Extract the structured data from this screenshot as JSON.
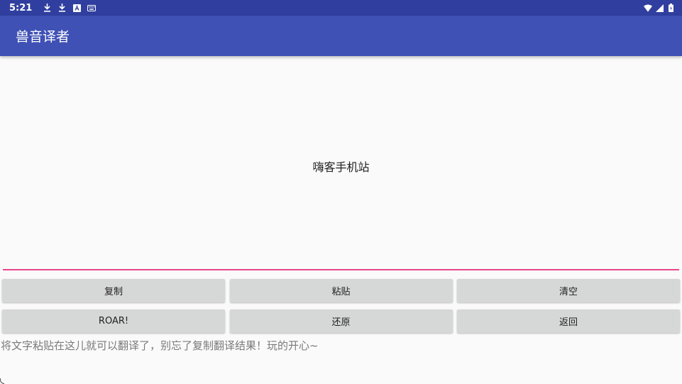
{
  "status_bar": {
    "time": "5:21",
    "left_icons": [
      "download-icon",
      "download-icon",
      "a-box-icon",
      "keyboard-icon"
    ],
    "right_icons": [
      "wifi-icon",
      "signal-icon",
      "battery-icon"
    ],
    "background": "#303f9f"
  },
  "app_bar": {
    "title": "兽音译者",
    "background": "#3f51b5"
  },
  "output": {
    "text": "嗨客手机站"
  },
  "input": {
    "underline_color": "#e8478b"
  },
  "buttons": {
    "row1": [
      "复制",
      "粘贴",
      "清空"
    ],
    "row2": [
      "ROAR!",
      "还原",
      "返回"
    ]
  },
  "hint": {
    "text": "将文字粘贴在这儿就可以翻译了，别忘了复制翻译结果！玩的开心~"
  }
}
